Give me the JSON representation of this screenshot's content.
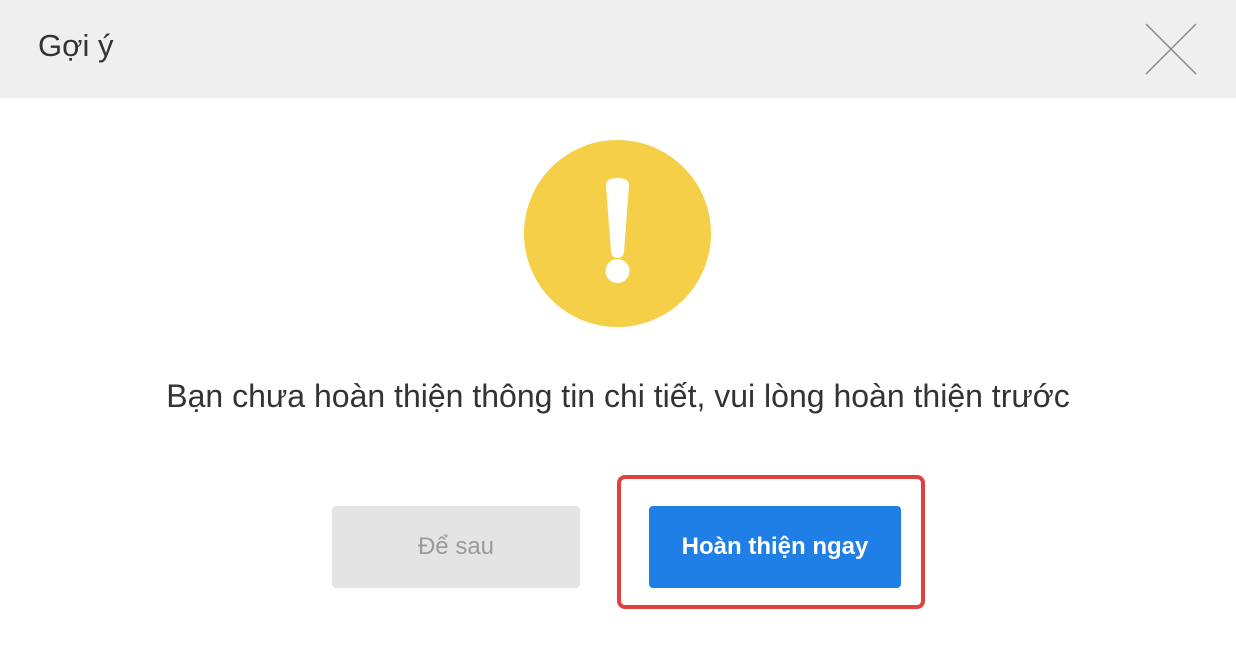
{
  "dialog": {
    "title": "Gợi ý",
    "close_icon": "close-icon",
    "warning_icon": "warning-exclamation-icon",
    "warning_color": "#f4cf47",
    "message": "Bạn chưa hoàn thiện thông tin chi tiết, vui lòng hoàn thiện trước",
    "later_button_label": "Để sau",
    "complete_button_label": "Hoàn thiện ngay",
    "primary_color": "#1f7fe7",
    "highlight_color": "#e0403e"
  }
}
